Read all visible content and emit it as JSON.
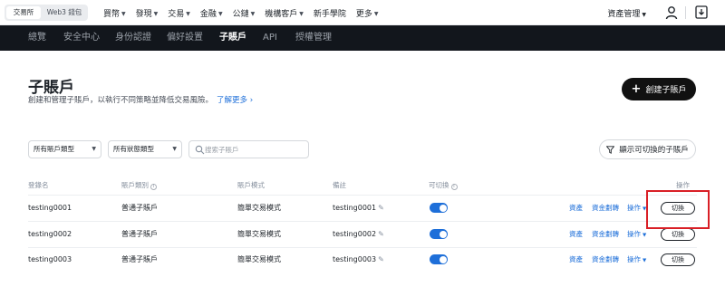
{
  "topnav": {
    "segments": [
      "交易所",
      "Web3 錢包"
    ],
    "menu": [
      {
        "label": "買幣",
        "caret": true
      },
      {
        "label": "發現",
        "caret": true
      },
      {
        "label": "交易",
        "caret": true
      },
      {
        "label": "金融",
        "caret": true
      },
      {
        "label": "公鏈",
        "caret": true
      },
      {
        "label": "機構客戶",
        "caret": true
      },
      {
        "label": "新手學院",
        "caret": false
      },
      {
        "label": "更多",
        "caret": true
      }
    ],
    "assets_label": "資產管理"
  },
  "account_nav": [
    "總覽",
    "安全中心",
    "身份認證",
    "偏好設置",
    "子賬戶",
    "API",
    "授權管理"
  ],
  "account_nav_active": 4,
  "header": {
    "title": "子賬戶",
    "subtitle": "創建和管理子賬戶，以執行不同策略並降低交易風險。",
    "learn_more": "了解更多",
    "create_label": "創建子賬戶"
  },
  "filters": {
    "type_select": "所有賬戶類型",
    "status_select": "所有狀態類型",
    "search_placeholder": "搜索子賬戶",
    "show_switchable": "顯示可切換的子賬戶"
  },
  "table": {
    "headers": [
      "登錄名",
      "賬戶類別",
      "賬戶模式",
      "備註",
      "可切換",
      "操作"
    ],
    "rows": [
      {
        "login": "testing0001",
        "category": "普通子賬戶",
        "mode": "簡單交易模式",
        "note": "testing0001",
        "switchable": true
      },
      {
        "login": "testing0002",
        "category": "普通子賬戶",
        "mode": "簡單交易模式",
        "note": "testing0002",
        "switchable": true
      },
      {
        "login": "testing0003",
        "category": "普通子賬戶",
        "mode": "簡單交易模式",
        "note": "testing0003",
        "switchable": true
      }
    ],
    "actions": {
      "assets": "資產",
      "transfer": "資金劃轉",
      "operate": "操作",
      "switch": "切換"
    }
  },
  "colors": {
    "accent": "#1e6fd9",
    "highlight": "#d91f26",
    "dark_bar": "#12161c"
  },
  "icons": [
    "user-icon",
    "download-icon",
    "search-icon",
    "filter-icon",
    "edit-icon",
    "plus-icon",
    "chevron-down-icon"
  ]
}
